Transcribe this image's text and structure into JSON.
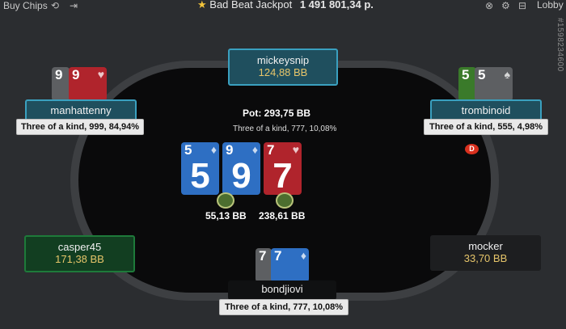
{
  "topbar": {
    "buy_chips": "Buy Chips",
    "refresh_icon": "⟲",
    "exit_icon": "⇥",
    "jackpot_label": "Bad Beat Jackpot",
    "jackpot_amount": "1 491 801,34 р.",
    "star_icon": "★",
    "lobby": "Lobby",
    "table_id": "#1598234600"
  },
  "pot": {
    "label": "Pot: 293,75 BB",
    "desc": "Three of a kind, 777, 10,08%"
  },
  "board": [
    {
      "rank": "5",
      "color": "blue",
      "suit": "♦"
    },
    {
      "rank": "9",
      "color": "blue",
      "suit": "♦"
    },
    {
      "rank": "7",
      "color": "red",
      "suit": "♥"
    }
  ],
  "bets": [
    "55,13 BB",
    "238,61 BB"
  ],
  "players": {
    "top": {
      "name": "mickeysnip",
      "stack": "124,88 BB"
    },
    "left": {
      "name": "manhattenny",
      "hand": "Three of a kind, 999, 84,94%",
      "cards": [
        "9",
        "9"
      ]
    },
    "right": {
      "name": "trombinoid",
      "hand": "Three of a kind, 555, 4,98%",
      "cards": [
        "5",
        "5"
      ]
    },
    "bottom_left": {
      "name": "casper45",
      "stack": "171,38 BB"
    },
    "bottom_right": {
      "name": "mocker",
      "stack": "33,70 BB"
    },
    "hero": {
      "name": "bondjiovi",
      "hand": "Three of a kind, 777, 10,08%",
      "cards": [
        "7",
        "7"
      ]
    }
  },
  "dealer": "D",
  "colors": {
    "accent_blue": "#3aa0bf",
    "accent_green": "#1e7a3a",
    "stack_yellow": "#e6c56a"
  }
}
